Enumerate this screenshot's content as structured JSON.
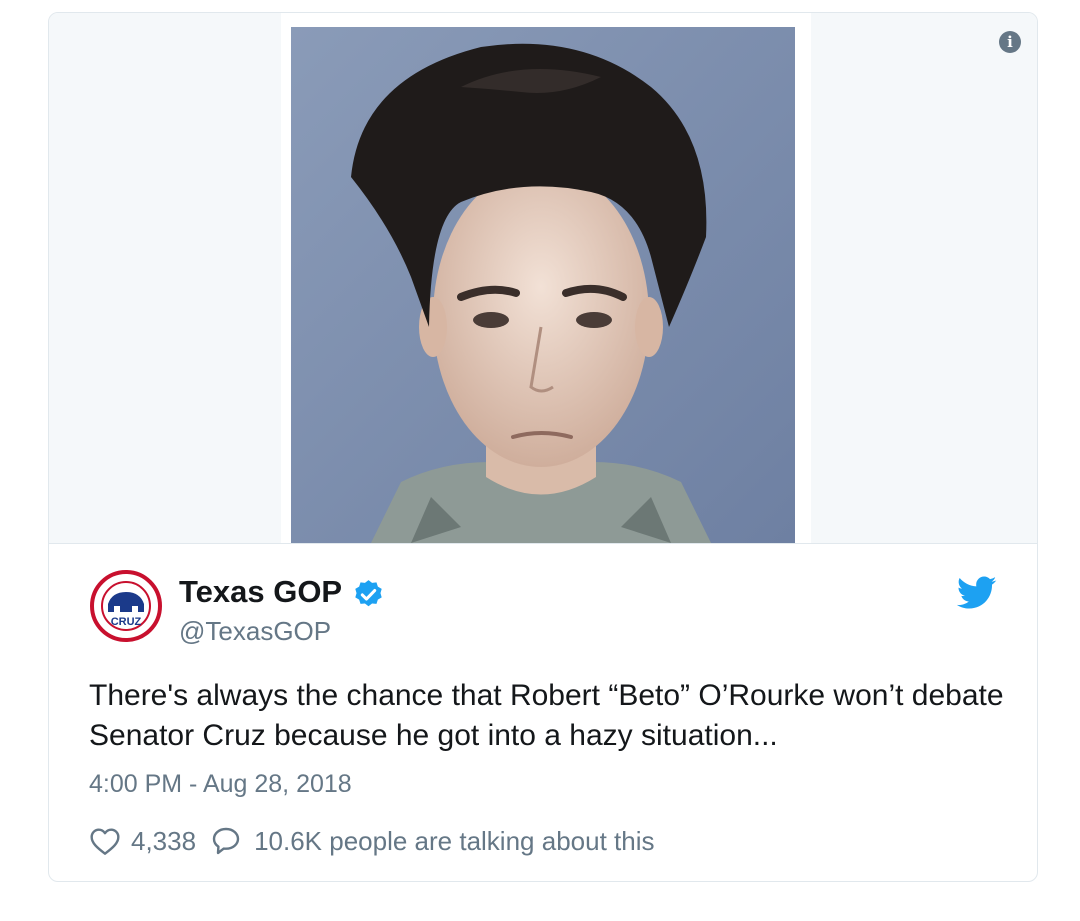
{
  "card": {
    "author": {
      "display_name": "Texas GOP",
      "handle": "@TexasGOP",
      "verified": true,
      "avatar_text": "CRUZ"
    },
    "tweet_text": "There's always the chance that Robert “Beto” O’Rourke won’t debate Senator Cruz because he got into a hazy situation...",
    "timestamp": "4:00 PM - Aug 28, 2018",
    "likes": "4,338",
    "conversation_text": "10.6K people are talking about this",
    "icons": [
      "info-icon",
      "verified-badge-icon",
      "twitter-bird-icon",
      "heart-icon",
      "speech-bubble-icon"
    ],
    "colors": {
      "accent": "#1da1f2",
      "muted": "#657786",
      "text": "#14171a"
    }
  }
}
